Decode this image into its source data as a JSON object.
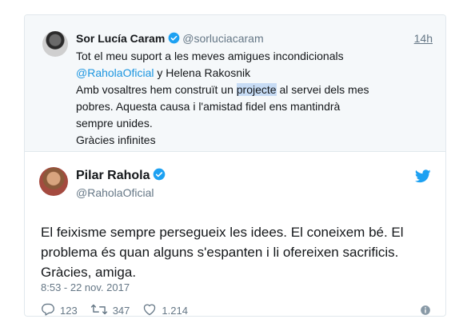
{
  "quoted_tweet": {
    "author_name": "Sor Lucía Caram",
    "handle": "@sorluciacaram",
    "time": "14h",
    "line1": "Tot el meu suport a les meves amigues incondicionals",
    "mention": "@RaholaOficial",
    "line2_rest": " y Helena Rakosnik",
    "line3_before": "Amb vosaltres hem construït un ",
    "line3_highlight": "projecte",
    "line3_after": " al servei dels mes pobres. Aquesta causa i l'amistad fidel ens mantindrà sempre unides.",
    "line4": "Gràcies infinites"
  },
  "tweet": {
    "author_name": "Pilar Rahola",
    "handle": "@RaholaOficial",
    "text": "El feixisme sempre persegueix les idees. El coneixem bé. El problema és quan alguns s'espanten i li ofereixen sacrificis. Gràcies, amiga.",
    "timestamp": "8:53 - 22 nov. 2017",
    "replies": "123",
    "retweets": "347",
    "likes": "1.214"
  },
  "colors": {
    "accent": "#1da1f2",
    "text": "#14171a",
    "muted": "#657786",
    "parent_bg": "#f5f8fa"
  },
  "icons": [
    "verified-badge-icon",
    "twitter-bird-icon",
    "reply-icon",
    "retweet-icon",
    "like-icon",
    "info-icon"
  ]
}
